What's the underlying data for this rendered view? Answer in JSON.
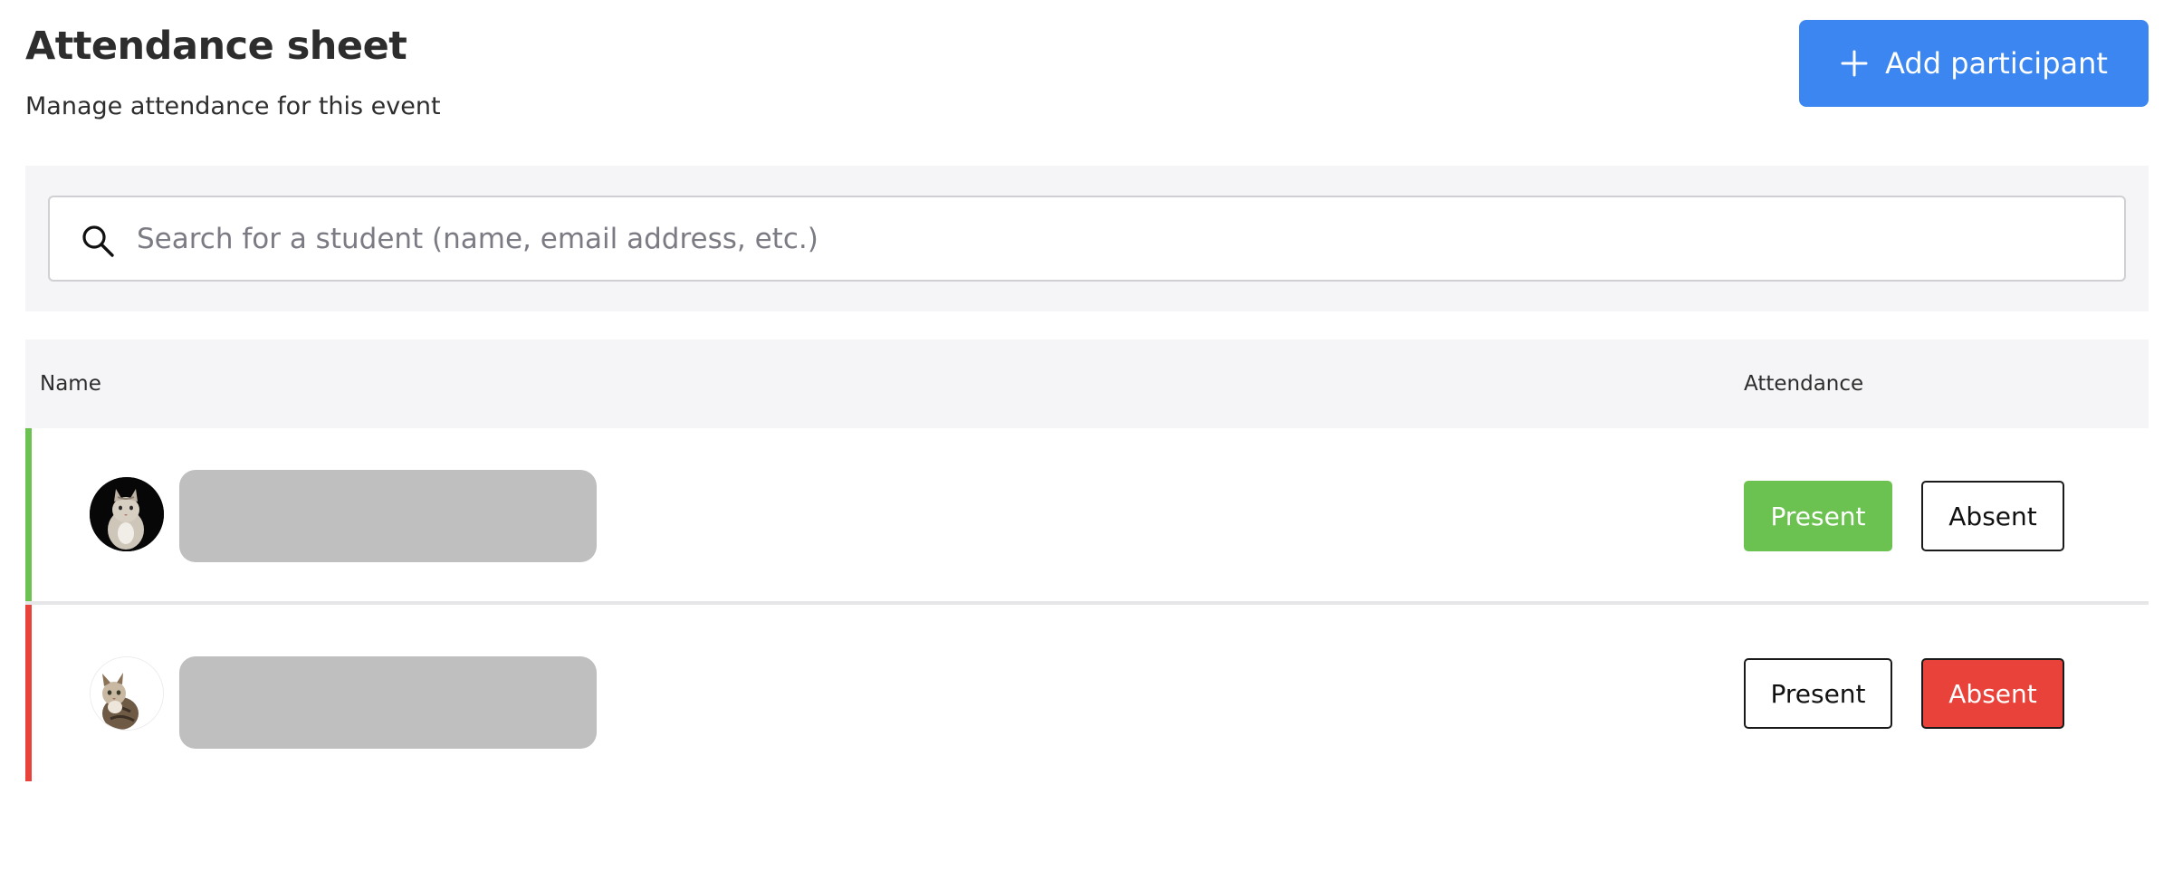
{
  "header": {
    "title": "Attendance sheet",
    "subtitle": "Manage attendance for this event",
    "add_button_label": "Add participant"
  },
  "search": {
    "placeholder": "Search for a student (name, email address, etc.)",
    "value": ""
  },
  "table": {
    "columns": [
      "Name",
      "Attendance"
    ],
    "rows": [
      {
        "status": "present",
        "present_label": "Present",
        "absent_label": "Absent"
      },
      {
        "status": "absent",
        "present_label": "Present",
        "absent_label": "Absent"
      }
    ]
  },
  "colors": {
    "accent": "#3b86f0",
    "present": "#6cc251",
    "absent": "#e8423a"
  },
  "icons": {
    "add": "plus-icon",
    "search": "search-icon"
  }
}
